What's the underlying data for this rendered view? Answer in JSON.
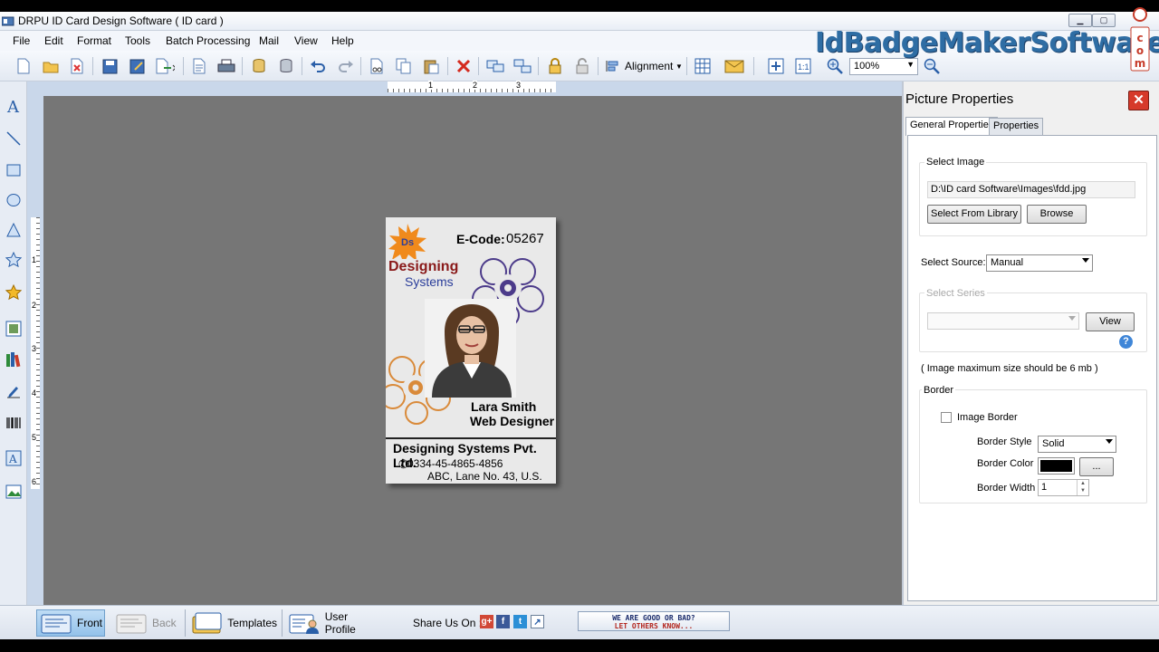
{
  "window": {
    "title": "DRPU ID Card Design Software ( ID card )"
  },
  "brand": {
    "text": "IdBadgeMakerSoftware",
    "suffix": ".com"
  },
  "menu": [
    "File",
    "Edit",
    "Format",
    "Tools",
    "Batch Processing",
    "Mail",
    "View",
    "Help"
  ],
  "toolbar": {
    "alignment_label": "Alignment",
    "zoom_value": "100%"
  },
  "ruler": {
    "h_marks": [
      "1",
      "2",
      "3"
    ],
    "v_marks": [
      "1",
      "2",
      "3",
      "4",
      "5",
      "6"
    ]
  },
  "card": {
    "ecode_label": "E-Code:",
    "ecode_value": "05267",
    "logo_text": "Ds",
    "company_line1": "Designing",
    "company_line2": "Systems",
    "person_name": "Lara Smith",
    "person_title": "Web Designer",
    "company_full": "Designing Systems Pvt. Ltd.",
    "phone": "0334-45-4865-4856",
    "address": "ABC, Lane No. 43, U.S."
  },
  "panel": {
    "title": "Picture Properties",
    "tabs": [
      "General Properties",
      "Properties"
    ],
    "select_image_label": "Select Image",
    "image_path": "D:\\ID card Software\\Images\\fdd.jpg",
    "select_library_btn": "Select From Library",
    "browse_btn": "Browse",
    "select_source_label": "Select Source:",
    "select_source_value": "Manual",
    "select_series_label": "Select Series",
    "view_btn": "View",
    "help_glyph": "?",
    "size_note": "( Image maximum size should be 6 mb )",
    "border_label": "Border",
    "image_border_label": "Image Border",
    "image_border_checked": false,
    "border_style_label": "Border Style",
    "border_style_value": "Solid",
    "border_color_label": "Border Color",
    "border_color": "#000000",
    "border_color_btn": "...",
    "border_width_label": "Border Width",
    "border_width_value": "1"
  },
  "bottom": {
    "front_label": "Front",
    "back_label": "Back",
    "templates_label": "Templates",
    "user_profile_label": "User Profile",
    "share_label": "Share Us On :",
    "social_icons": [
      "google-plus",
      "facebook",
      "twitter",
      "share"
    ],
    "feedback_line1": "WE ARE GOOD OR BAD?",
    "feedback_line2": "LET OTHERS KNOW..."
  },
  "colors": {
    "accent": "#2e6da4",
    "canvas_bg": "#767676",
    "close_red": "#d6392a",
    "company_red": "#8a1a1a",
    "company_blue": "#2a3d9a",
    "flower_purple": "#4c3b8a",
    "flower_orange": "#d98a3a"
  }
}
